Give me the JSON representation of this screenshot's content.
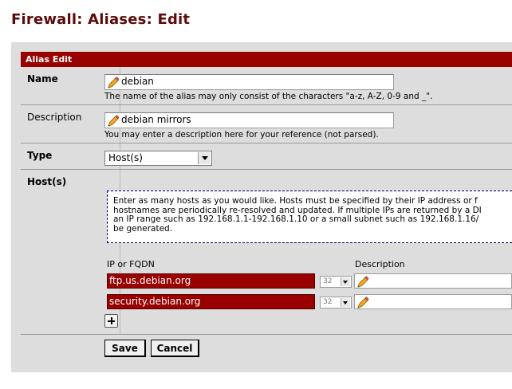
{
  "page": {
    "title": "Firewall: Aliases: Edit"
  },
  "section": {
    "title": "Alias Edit"
  },
  "name": {
    "label": "Name",
    "value": "debian",
    "hint": "The name of the alias may only consist of the characters \"a-z, A-Z, 0-9 and _\"."
  },
  "description": {
    "label": "Description",
    "value": "debian mirrors",
    "hint": "You may enter a description here for your reference (not parsed)."
  },
  "type": {
    "label": "Type",
    "selected": "Host(s)"
  },
  "hosts": {
    "label": "Host(s)",
    "info_lines": [
      "Enter as many hosts as you would like. Hosts must be specified by their IP address or f",
      "hostnames are periodically re-resolved and updated. If multiple IPs are returned by a DI",
      "an IP range such as 192.168.1.1-192.168.1.10 or a small subnet such as 192.168.1.16/",
      "be generated."
    ],
    "col_ip": "IP or FQDN",
    "col_desc": "Description",
    "entries": [
      {
        "ip": "ftp.us.debian.org",
        "mask": "32",
        "description": ""
      },
      {
        "ip": "security.debian.org",
        "mask": "32",
        "description": ""
      }
    ]
  },
  "buttons": {
    "save": "Save",
    "cancel": "Cancel"
  },
  "colors": {
    "accent": "#990000",
    "title": "#5c0a0a",
    "panel": "#dddddd"
  },
  "icons": {
    "edit": "pencil-icon",
    "add": "plus-icon"
  }
}
